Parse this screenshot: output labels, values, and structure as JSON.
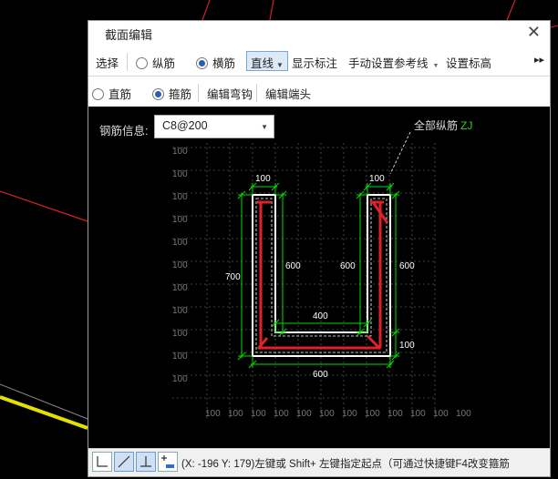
{
  "dialog": {
    "title": "截面编辑",
    "close_icon": "close-icon"
  },
  "toolbar1": {
    "select": "选择",
    "longitudinal": "纵筋",
    "transverse": "横筋",
    "line_mode": "直线",
    "show_labels": "显示标注",
    "manual_reference_line": "手动设置参考线",
    "set_elevation": "设置标高",
    "more_icon": "double-chevron-right-icon"
  },
  "toolbar2": {
    "straight_bar": "直筋",
    "stirrup": "箍筋",
    "edit_hook": "编辑弯钩",
    "edit_end": "编辑端头"
  },
  "canvas": {
    "rebar_info_label": "钢筋信息:",
    "rebar_info_value": "C8@200",
    "all_longitudinal_label": "全部纵筋",
    "all_longitudinal_code": "ZJ",
    "grid_label": "100",
    "dims": {
      "top_left_width": "100",
      "top_right_width": "100",
      "left_outer_height": "700",
      "left_inner_height": "600",
      "right_inner_height": "600",
      "right_outer_height": "600",
      "inner_bottom_width": "400",
      "bottom_thickness": "100",
      "overall_width": "600"
    },
    "colors": {
      "outline": "#ffffff",
      "dimension": "#00ff00",
      "rebar": "#e0202a",
      "grid": "#5a5a5a"
    }
  },
  "statusbar": {
    "text": "(X: -196 Y: 179)左键或 Shift+ 左键指定起点（可通过快捷键F4改变箍筋",
    "buttons": [
      "orthogonal-icon",
      "slope-line-icon",
      "perpendicular-icon",
      "add-point-icon"
    ]
  }
}
